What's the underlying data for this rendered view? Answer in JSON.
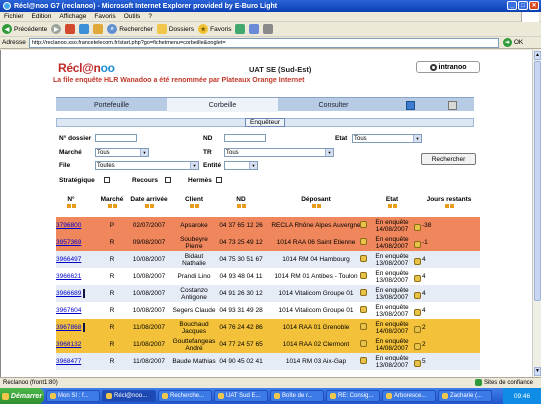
{
  "window": {
    "title": "Récl@noo G7 (reclanoo) - Microsoft Internet Explorer provided by E-Buro Light"
  },
  "menu": [
    "Fichier",
    "Edition",
    "Affichage",
    "Favoris",
    "Outils",
    "?"
  ],
  "toolbar": {
    "back_label": "Précédente",
    "search_label": "Rechercher",
    "folders_label": "Dossiers",
    "favorites_label": "Favoris"
  },
  "address": {
    "label": "Adresse",
    "url": "http://reclanoo.sso.francetelecom.fr/start.php?go=fichetmenu=corbeille&onglet=",
    "go_label": "OK"
  },
  "header": {
    "logo_part1": "Récl@n",
    "logo_part2": "oo",
    "uat": "UAT SE (Sud-Est)",
    "intranoo": "intranoo",
    "notice": "La file enquête HLR Wanadoo a été renommée par Plateaux Orange Internet"
  },
  "tabs": [
    "Portefeuille",
    "Corbeille",
    "Consulter"
  ],
  "form": {
    "section_title": "Enquêteur",
    "dossier_label": "N° dossier",
    "nd_label": "ND",
    "etat_label": "Etat",
    "etat_value": "Tous",
    "marche_label": "Marché",
    "marche_value": "Tous",
    "tr_label": "TR",
    "tr_value": "Tous",
    "file_label": "File",
    "file_value": "Toutes",
    "entite_label": "Entité",
    "entite_value": "",
    "search_button": "Rechercher",
    "strategique_label": "Stratégique",
    "recours_label": "Recours",
    "hermes_label": "Hermès"
  },
  "table": {
    "headers": [
      "N°",
      "Marché",
      "Date arrivée",
      "Client",
      "ND",
      "Déposant",
      "Etat",
      "Jours restants"
    ],
    "rows": [
      {
        "num": "3796800",
        "marche": "P",
        "date": "02/07/2007",
        "client": "Apsaroke",
        "nd": "04 37 65 12 26",
        "deposant": "RECLA Rhône Alpes Auvergne",
        "etat": "En enquête 14/08/2007",
        "jours": "-38",
        "bg": "#f0875c",
        "marker": false
      },
      {
        "num": "3957369",
        "marche": "R",
        "date": "09/08/2007",
        "client": "Soubeyre Pierre",
        "nd": "04 73 25 49 12",
        "deposant": "1014 RAA 06 Saint Etienne",
        "etat": "En enquête 14/08/2007",
        "jours": "-1",
        "bg": "#f0875c",
        "marker": false
      },
      {
        "num": "3966497",
        "marche": "R",
        "date": "10/08/2007",
        "client": "Bidaut Nathalie",
        "nd": "04 75 30 51 67",
        "deposant": "1014 RM 04 Hambourg",
        "etat": "En enquête 13/08/2007",
        "jours": "4",
        "bg": "#e6ecf6",
        "marker": false
      },
      {
        "num": "3966621",
        "marche": "R",
        "date": "10/08/2007",
        "client": "Prandi Lino",
        "nd": "04 93 48 04 11",
        "deposant": "1014 RM 01 Antibes - Toulon",
        "etat": "En enquête 13/08/2007",
        "jours": "4",
        "bg": "#ffffff",
        "marker": false
      },
      {
        "num": "3966689",
        "marche": "R",
        "date": "10/08/2007",
        "client": "Costanzo Antigone",
        "nd": "04 91 26 30 12",
        "deposant": "1014 Vitalicom Groupe 01",
        "etat": "En enquête 13/08/2007",
        "jours": "4",
        "bg": "#e6ecf6",
        "marker": true
      },
      {
        "num": "3967604",
        "marche": "R",
        "date": "10/08/2007",
        "client": "Segers Claude",
        "nd": "04 93 31 49 28",
        "deposant": "1014 Vitalicom Groupe 01",
        "etat": "En enquête 13/08/2007",
        "jours": "4",
        "bg": "#ffffff",
        "marker": false
      },
      {
        "num": "3967868",
        "marche": "R",
        "date": "11/08/2007",
        "client": "Bouchaud Jacques",
        "nd": "04 76 24 42 86",
        "deposant": "1014 RAA 01 Grenoble",
        "etat": "En enquête 14/08/2007",
        "jours": "2",
        "bg": "#f3c23a",
        "marker": true
      },
      {
        "num": "3968132",
        "marche": "R",
        "date": "11/08/2007",
        "client": "Gouttefangeas André",
        "nd": "04 77 24 57 65",
        "deposant": "1014 RAA 02 Clermont",
        "etat": "En enquête 14/08/2007",
        "jours": "2",
        "bg": "#f3c23a",
        "marker": false
      },
      {
        "num": "3968477",
        "marche": "R",
        "date": "11/08/2007",
        "client": "Baude Mathias",
        "nd": "04 90 45 02 41",
        "deposant": "1014 RM 03 Aix-Gap",
        "etat": "En enquête 13/08/2007",
        "jours": "5",
        "bg": "#e6ecf6",
        "marker": false
      }
    ]
  },
  "status": {
    "text": "Reclanoo (front1:80)",
    "zone": "Sites de confiance"
  },
  "taskbar": {
    "start": "Démarrer",
    "items": [
      "Mon SI : f...",
      "Récl@noo...",
      "Recherche...",
      "UAT Sud E...",
      "Boîte de r...",
      "RE: Consig...",
      "Arboresce...",
      "Zacharie (..."
    ],
    "clock": "09:46"
  }
}
